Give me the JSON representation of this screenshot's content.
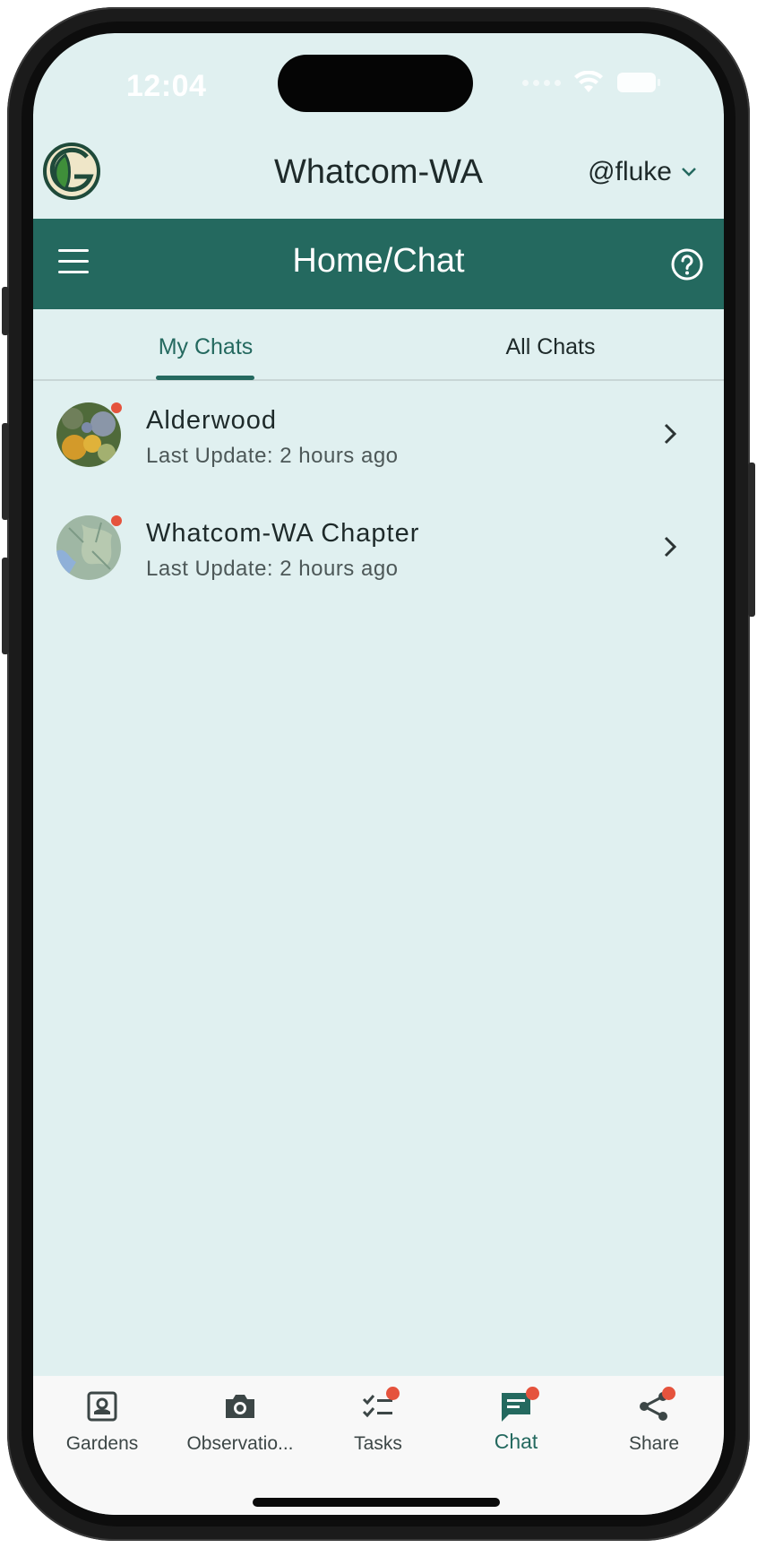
{
  "status_bar": {
    "time": "12:04"
  },
  "header": {
    "garden_name": "Whatcom-WA",
    "username": "@fluke"
  },
  "toolbar": {
    "title": "Home/Chat"
  },
  "tabs": [
    {
      "label": "My Chats",
      "active": true
    },
    {
      "label": "All Chats",
      "active": false
    }
  ],
  "chats": [
    {
      "title": "Alderwood",
      "subtitle": "Last Update: 2 hours ago",
      "unread": true,
      "avatar": "garden-photo"
    },
    {
      "title": "Whatcom-WA Chapter",
      "subtitle": "Last Update: 2 hours ago",
      "unread": true,
      "avatar": "map-photo"
    }
  ],
  "bottom_nav": [
    {
      "label": "Gardens",
      "icon": "garden-icon",
      "badge": false,
      "active": false
    },
    {
      "label": "Observatio...",
      "icon": "camera-icon",
      "badge": false,
      "active": false
    },
    {
      "label": "Tasks",
      "icon": "tasks-icon",
      "badge": true,
      "active": false
    },
    {
      "label": "Chat",
      "icon": "chat-icon",
      "badge": true,
      "active": true
    },
    {
      "label": "Share",
      "icon": "share-icon",
      "badge": true,
      "active": false
    }
  ],
  "colors": {
    "primary": "#24695f",
    "background": "#e0f0f0",
    "badge": "#e5533d",
    "text": "#1e2a2a"
  }
}
